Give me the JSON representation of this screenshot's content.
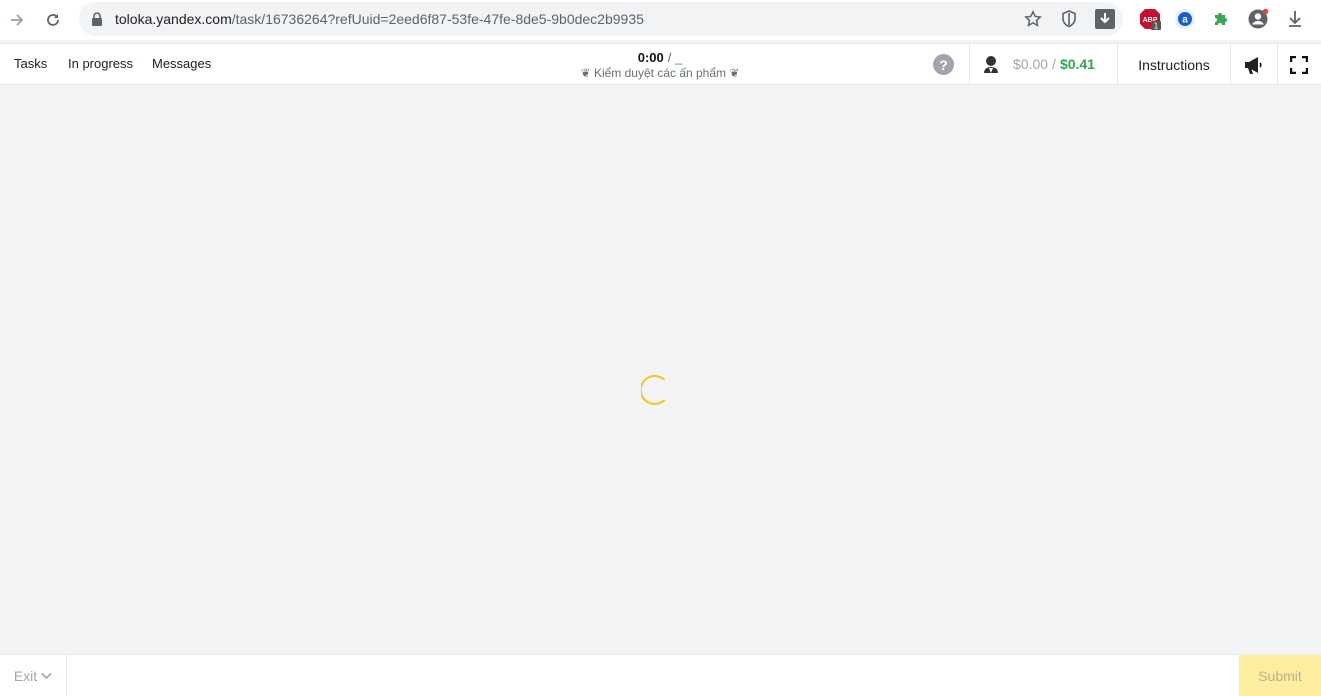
{
  "browser": {
    "url_host": "toloka.yandex.com",
    "url_path": "/task/16736264?refUuid=2eed6f87-53fe-47fe-8de5-9b0dec2b9935",
    "icons": [
      "forward-icon",
      "reload-icon",
      "lock-icon",
      "star-icon",
      "shield-icon",
      "download-box-icon",
      "adblock-icon",
      "ext-a-icon",
      "puzzle-icon",
      "profile-icon",
      "download-icon"
    ],
    "adblock_badge": "1",
    "adblock_label": "ABP"
  },
  "header": {
    "nav": [
      "Tasks",
      "In progress",
      "Messages"
    ],
    "timer": "0:00",
    "timer_sep": "/",
    "timer_limit": "_",
    "project_title": "❦ Kiểm duyệt các ấn phẩm ❦",
    "help": "?",
    "earnings_current": "$0.00",
    "earnings_sep": "/",
    "earnings_total": "$0.41",
    "instructions": "Instructions",
    "accent_green": "#2ea84f",
    "muted_gray": "#a1a6ad"
  },
  "main": {
    "spinner_color": "#f5c518"
  },
  "footer": {
    "exit": "Exit",
    "submit": "Submit",
    "submit_color": "#fdeea0"
  }
}
